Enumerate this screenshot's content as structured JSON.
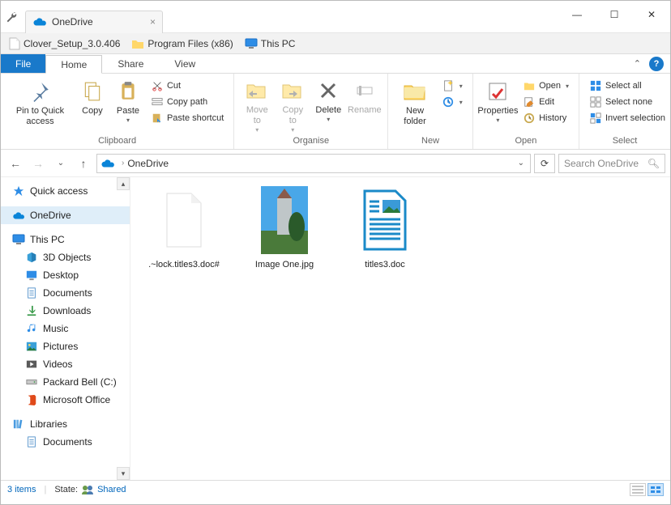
{
  "tab": {
    "title": "OneDrive"
  },
  "bookmarks": [
    {
      "label": "Clover_Setup_3.0.406",
      "icon": "file"
    },
    {
      "label": "Program Files (x86)",
      "icon": "folder"
    },
    {
      "label": "This PC",
      "icon": "monitor"
    }
  ],
  "menu": {
    "file": "File",
    "tabs": [
      "Home",
      "Share",
      "View"
    ]
  },
  "ribbon": {
    "clipboard": {
      "label": "Clipboard",
      "pin": "Pin to Quick access",
      "copy": "Copy",
      "paste": "Paste",
      "cut": "Cut",
      "copy_path": "Copy path",
      "paste_shortcut": "Paste shortcut"
    },
    "organise": {
      "label": "Organise",
      "move": "Move to",
      "copy": "Copy to",
      "delete": "Delete",
      "rename": "Rename"
    },
    "new": {
      "label": "New",
      "new_folder": "New folder"
    },
    "open": {
      "label": "Open",
      "properties": "Properties",
      "open": "Open",
      "edit": "Edit",
      "history": "History"
    },
    "select": {
      "label": "Select",
      "all": "Select all",
      "none": "Select none",
      "invert": "Invert selection"
    }
  },
  "address": {
    "root_icon": "onedrive",
    "path": "OneDrive"
  },
  "search": {
    "placeholder": "Search OneDrive"
  },
  "sidebar": {
    "quick": "Quick access",
    "onedrive": "OneDrive",
    "thispc": "This PC",
    "children": [
      "3D Objects",
      "Desktop",
      "Documents",
      "Downloads",
      "Music",
      "Pictures",
      "Videos",
      "Packard Bell (C:)",
      "Microsoft Office"
    ],
    "libraries": "Libraries",
    "lib_children": [
      "Documents"
    ]
  },
  "files": [
    {
      "name": ".~lock.titles3.doc#",
      "type": "blank"
    },
    {
      "name": "Image One.jpg",
      "type": "image"
    },
    {
      "name": "titles3.doc",
      "type": "doc"
    }
  ],
  "status": {
    "count": "3 items",
    "state_label": "State:",
    "state_value": "Shared"
  }
}
